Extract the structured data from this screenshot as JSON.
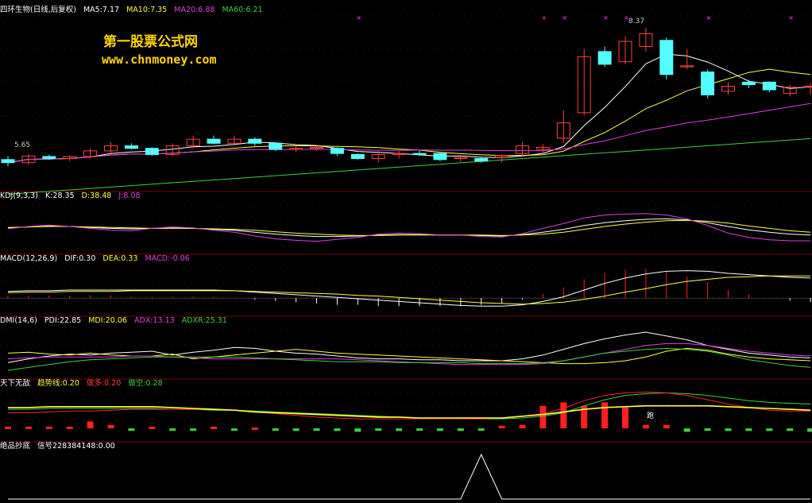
{
  "colors": {
    "bg": "#000000",
    "grid": "#7a0000",
    "up": "#ff4040",
    "down": "#54ffff",
    "white": "#ffffff",
    "yellow": "#ffff40",
    "magenta": "#e040e0",
    "green": "#40d040",
    "pink": "#ff40ff",
    "red": "#ff2020"
  },
  "watermark": {
    "line1": "第一股票公式网",
    "line2": "www.chnmoney.com",
    "color": "#ffd400"
  },
  "price_panel": {
    "header": {
      "title": "四环生物(日线,后复权)",
      "ma5": "MA5:7.17",
      "ma10": "MA10:7.35",
      "ma20": "MA20:6.88",
      "ma60": "MA60:6.21"
    },
    "high_label": "8.37",
    "low_label": "5.65"
  },
  "kdj_panel": {
    "header": {
      "title": "KDJ(9,3,3)",
      "k": "K:28.35",
      "d": "D:38.48",
      "j": "J:8.08"
    }
  },
  "macd_panel": {
    "header": {
      "title": "MACD(12,26,9)",
      "dif": "DIF:0.30",
      "dea": "DEA:0.33",
      "macd": "MACD:-0.06"
    }
  },
  "dmi_panel": {
    "header": {
      "title": "DMI(14,6)",
      "pdi": "PDI:22.85",
      "mdi": "MDI:20.06",
      "adx": "ADX:13.13",
      "adxr": "ADXR:25.31"
    }
  },
  "tx_panel": {
    "header": {
      "title": "天下无敌",
      "trend": "趋势线:0.20",
      "long": "做多:0.20",
      "short": "做空:0.28"
    },
    "signal_label": "跑"
  },
  "bottom_panel": {
    "header": {
      "title": "绝品抄底",
      "signal": "信号228384148:0.00"
    }
  },
  "chart_data": [
    {
      "type": "candlestick",
      "title": "四环生物(日线,后复权)",
      "candles": [
        [
          5.78,
          5.85,
          5.65,
          5.72
        ],
        [
          5.72,
          5.9,
          5.68,
          5.85
        ],
        [
          5.84,
          5.88,
          5.78,
          5.8
        ],
        [
          5.8,
          5.86,
          5.75,
          5.84
        ],
        [
          5.84,
          6.0,
          5.8,
          5.95
        ],
        [
          5.95,
          6.12,
          5.9,
          6.05
        ],
        [
          6.05,
          6.1,
          5.98,
          6.0
        ],
        [
          6.0,
          6.02,
          5.85,
          5.88
        ],
        [
          5.88,
          6.1,
          5.85,
          6.05
        ],
        [
          6.05,
          6.25,
          6.0,
          6.18
        ],
        [
          6.18,
          6.25,
          6.08,
          6.1
        ],
        [
          6.1,
          6.25,
          6.05,
          6.18
        ],
        [
          6.18,
          6.22,
          6.05,
          6.1
        ],
        [
          6.1,
          6.12,
          5.95,
          5.98
        ],
        [
          5.98,
          6.05,
          5.92,
          6.0
        ],
        [
          6.0,
          6.05,
          5.95,
          6.02
        ],
        [
          6.0,
          6.02,
          5.85,
          5.9
        ],
        [
          5.88,
          5.9,
          5.78,
          5.8
        ],
        [
          5.8,
          5.95,
          5.72,
          5.88
        ],
        [
          5.88,
          5.95,
          5.8,
          5.9
        ],
        [
          5.9,
          5.95,
          5.85,
          5.88
        ],
        [
          5.9,
          5.92,
          5.75,
          5.78
        ],
        [
          5.8,
          5.85,
          5.74,
          5.82
        ],
        [
          5.8,
          5.82,
          5.72,
          5.75
        ],
        [
          5.82,
          5.88,
          5.72,
          5.86
        ],
        [
          5.9,
          6.12,
          5.85,
          6.05
        ],
        [
          5.98,
          6.08,
          5.9,
          6.02
        ],
        [
          6.2,
          6.75,
          6.1,
          6.5
        ],
        [
          6.7,
          7.95,
          6.65,
          7.8
        ],
        [
          7.9,
          8.0,
          7.6,
          7.65
        ],
        [
          7.7,
          8.2,
          7.65,
          8.1
        ],
        [
          8.0,
          8.37,
          7.9,
          8.25
        ],
        [
          8.12,
          8.18,
          7.35,
          7.45
        ],
        [
          7.6,
          7.95,
          7.55,
          7.62
        ],
        [
          7.5,
          7.55,
          6.98,
          7.05
        ],
        [
          7.12,
          7.3,
          7.05,
          7.22
        ],
        [
          7.3,
          7.35,
          7.18,
          7.25
        ],
        [
          7.3,
          7.32,
          7.1,
          7.15
        ],
        [
          7.08,
          7.25,
          7.02,
          7.2
        ],
        [
          7.2,
          7.28,
          7.05,
          7.22
        ]
      ],
      "high_marked": 8.37,
      "low_marked": 5.65,
      "ylim": [
        5.2,
        8.6
      ]
    },
    {
      "type": "line",
      "title": "KDJ(9,3,3)",
      "series": [
        {
          "name": "K",
          "values": [
            47,
            49,
            51,
            50,
            48,
            46,
            45,
            46,
            47,
            46,
            44,
            42,
            38,
            34,
            31,
            29,
            29,
            30,
            32,
            33,
            33,
            32,
            32,
            31,
            30,
            33,
            38,
            44,
            52,
            58,
            62,
            65,
            66,
            64,
            58,
            50,
            43,
            38,
            34,
            32
          ]
        },
        {
          "name": "D",
          "values": [
            48,
            49,
            50,
            50,
            49,
            48,
            47,
            46,
            46,
            46,
            45,
            44,
            42,
            39,
            36,
            34,
            32,
            31,
            31,
            32,
            32,
            32,
            32,
            32,
            31,
            32,
            34,
            38,
            44,
            50,
            55,
            59,
            62,
            63,
            61,
            57,
            51,
            46,
            41,
            38
          ]
        },
        {
          "name": "J",
          "values": [
            45,
            50,
            53,
            50,
            46,
            42,
            41,
            46,
            49,
            47,
            42,
            38,
            30,
            24,
            21,
            19,
            23,
            27,
            34,
            36,
            35,
            32,
            32,
            29,
            28,
            35,
            46,
            56,
            68,
            74,
            76,
            77,
            74,
            66,
            52,
            36,
            27,
            22,
            20,
            20
          ]
        }
      ],
      "ylim": [
        0,
        100
      ]
    },
    {
      "type": "line",
      "title": "MACD(12,26,9)",
      "series": [
        {
          "name": "DIF",
          "values": [
            0.1,
            0.11,
            0.11,
            0.12,
            0.12,
            0.12,
            0.12,
            0.12,
            0.12,
            0.12,
            0.12,
            0.11,
            0.09,
            0.07,
            0.05,
            0.03,
            0.01,
            -0.01,
            -0.03,
            -0.05,
            -0.07,
            -0.09,
            -0.11,
            -0.12,
            -0.12,
            -0.1,
            -0.05,
            0.02,
            0.12,
            0.22,
            0.3,
            0.36,
            0.4,
            0.41,
            0.4,
            0.37,
            0.35,
            0.33,
            0.31,
            0.3
          ]
        },
        {
          "name": "DEA",
          "values": [
            0.08,
            0.09,
            0.09,
            0.1,
            0.1,
            0.1,
            0.11,
            0.11,
            0.11,
            0.11,
            0.11,
            0.11,
            0.1,
            0.09,
            0.08,
            0.07,
            0.06,
            0.04,
            0.03,
            0.01,
            -0.01,
            -0.03,
            -0.05,
            -0.07,
            -0.08,
            -0.09,
            -0.08,
            -0.06,
            -0.02,
            0.03,
            0.09,
            0.14,
            0.2,
            0.25,
            0.28,
            0.31,
            0.32,
            0.33,
            0.33,
            0.33
          ]
        },
        {
          "name": "MACD",
          "values": [
            0.04,
            0.04,
            0.04,
            0.04,
            0.04,
            0.04,
            0.02,
            0.02,
            0.02,
            0.02,
            0.02,
            0.0,
            -0.02,
            -0.04,
            -0.06,
            -0.08,
            -0.1,
            -0.1,
            -0.12,
            -0.12,
            -0.12,
            -0.12,
            -0.12,
            -0.1,
            -0.08,
            -0.02,
            0.06,
            0.16,
            0.28,
            0.38,
            0.42,
            0.44,
            0.4,
            0.32,
            0.24,
            0.12,
            0.06,
            0.0,
            -0.04,
            -0.06
          ]
        }
      ],
      "ylim": [
        -0.2,
        0.5
      ]
    },
    {
      "type": "line",
      "title": "DMI(14,6)",
      "series": [
        {
          "name": "PDI",
          "values": [
            18,
            22,
            25,
            27,
            26,
            28,
            29,
            30,
            26,
            29,
            31,
            34,
            33,
            30,
            28,
            27,
            25,
            23,
            22,
            22,
            21,
            21,
            20,
            20,
            20,
            22,
            26,
            32,
            38,
            43,
            47,
            50,
            46,
            42,
            36,
            32,
            28,
            26,
            24,
            23
          ]
        },
        {
          "name": "MDI",
          "values": [
            28,
            29,
            27,
            26,
            28,
            26,
            25,
            25,
            27,
            22,
            24,
            26,
            28,
            30,
            32,
            30,
            28,
            27,
            26,
            25,
            24,
            23,
            22,
            21,
            20,
            19,
            18,
            17,
            17,
            18,
            20,
            24,
            30,
            33,
            31,
            27,
            24,
            22,
            21,
            20
          ]
        },
        {
          "name": "ADX",
          "values": [
            22,
            23,
            24,
            24,
            24,
            24,
            25,
            25,
            24,
            23,
            22,
            22,
            22,
            22,
            22,
            22,
            22,
            21,
            20,
            19,
            18,
            17,
            16,
            16,
            16,
            16,
            17,
            20,
            24,
            28,
            32,
            36,
            38,
            38,
            36,
            33,
            30,
            28,
            26,
            25
          ]
        },
        {
          "name": "ADXR",
          "values": [
            10,
            13,
            16,
            19,
            21,
            22,
            23,
            24,
            24,
            24,
            24,
            24,
            23,
            22,
            21,
            20,
            19,
            19,
            19,
            18,
            18,
            18,
            18,
            17,
            17,
            17,
            18,
            20,
            24,
            28,
            30,
            32,
            33,
            32,
            30,
            26,
            21,
            18,
            15,
            13
          ]
        }
      ],
      "ylim": [
        5,
        55
      ]
    },
    {
      "type": "bar",
      "title": "天下无敌",
      "series": [
        {
          "name": "趋势线",
          "values": [
            0.24,
            0.24,
            0.25,
            0.25,
            0.25,
            0.25,
            0.25,
            0.25,
            0.24,
            0.23,
            0.22,
            0.21,
            0.19,
            0.18,
            0.17,
            0.16,
            0.15,
            0.14,
            0.13,
            0.13,
            0.12,
            0.12,
            0.12,
            0.12,
            0.12,
            0.14,
            0.16,
            0.19,
            0.22,
            0.24,
            0.25,
            0.26,
            0.26,
            0.26,
            0.26,
            0.25,
            0.24,
            0.23,
            0.22,
            0.21
          ]
        },
        {
          "name": "做多",
          "values": [
            0.18,
            0.18,
            0.19,
            0.2,
            0.2,
            0.21,
            0.22,
            0.22,
            0.22,
            0.22,
            0.22,
            0.21,
            0.19,
            0.17,
            0.15,
            0.13,
            0.12,
            0.11,
            0.11,
            0.11,
            0.11,
            0.11,
            0.11,
            0.11,
            0.12,
            0.14,
            0.17,
            0.23,
            0.32,
            0.38,
            0.41,
            0.42,
            0.41,
            0.38,
            0.33,
            0.28,
            0.24,
            0.21,
            0.2,
            0.2
          ]
        },
        {
          "name": "做空",
          "values": [
            0.22,
            0.22,
            0.23,
            0.23,
            0.23,
            0.23,
            0.23,
            0.23,
            0.22,
            0.22,
            0.21,
            0.21,
            0.2,
            0.19,
            0.18,
            0.17,
            0.16,
            0.15,
            0.14,
            0.13,
            0.12,
            0.12,
            0.12,
            0.11,
            0.11,
            0.12,
            0.14,
            0.18,
            0.26,
            0.33,
            0.38,
            0.4,
            0.41,
            0.4,
            0.38,
            0.35,
            0.32,
            0.3,
            0.29,
            0.28
          ]
        },
        {
          "name": "柱",
          "values": [
            0.02,
            0.02,
            0.02,
            0.02,
            0.08,
            0.04,
            -0.01,
            0.02,
            -0.01,
            -0.01,
            0.02,
            -0.02,
            0.01,
            -0.02,
            -0.03,
            -0.02,
            -0.03,
            -0.04,
            -0.02,
            -0.03,
            -0.02,
            -0.03,
            -0.03,
            -0.02,
            0.03,
            0.04,
            0.26,
            0.3,
            0.26,
            0.3,
            0.24,
            0.04,
            0.04,
            -0.04,
            -0.01,
            -0.03,
            -0.03,
            -0.03,
            -0.03,
            -0.04
          ]
        }
      ],
      "ylim": [
        -0.1,
        0.45
      ]
    },
    {
      "type": "line",
      "title": "绝品抄底",
      "series": [
        {
          "name": "信号228384148",
          "values": [
            0,
            0,
            0,
            0,
            0,
            0,
            0,
            0,
            0,
            0,
            0,
            0,
            0,
            0,
            0,
            0,
            0,
            0,
            0,
            0,
            0,
            0,
            0,
            1,
            0,
            0,
            0,
            0,
            0,
            0,
            0,
            0,
            0,
            0,
            0,
            0,
            0,
            0,
            0,
            0
          ]
        }
      ],
      "ylim": [
        0,
        1
      ]
    }
  ]
}
